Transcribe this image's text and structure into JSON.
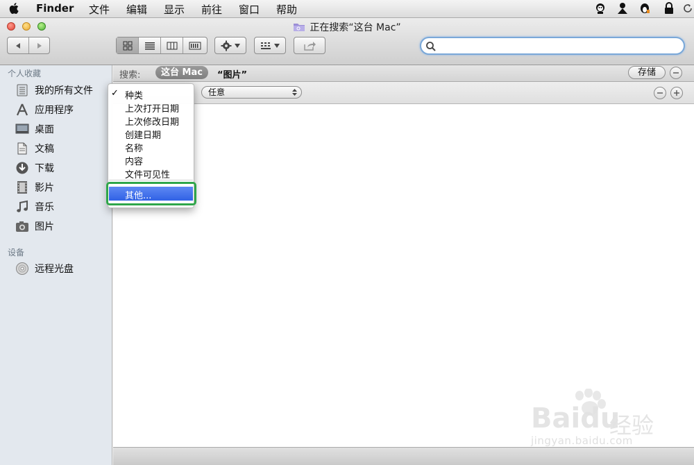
{
  "menubar": {
    "app": "Finder",
    "items": [
      "文件",
      "编辑",
      "显示",
      "前往",
      "窗口",
      "帮助"
    ]
  },
  "window": {
    "title": "正在搜索“这台 Mac”"
  },
  "toolbar": {
    "search_placeholder": ""
  },
  "sidebar": {
    "favorites_header": "个人收藏",
    "favorites": [
      {
        "label": "我的所有文件",
        "icon": "all-files-icon"
      },
      {
        "label": "应用程序",
        "icon": "applications-icon"
      },
      {
        "label": "桌面",
        "icon": "desktop-icon"
      },
      {
        "label": "文稿",
        "icon": "documents-icon"
      },
      {
        "label": "下载",
        "icon": "downloads-icon"
      },
      {
        "label": "影片",
        "icon": "movies-icon"
      },
      {
        "label": "音乐",
        "icon": "music-icon"
      },
      {
        "label": "图片",
        "icon": "pictures-icon"
      }
    ],
    "devices_header": "设备",
    "devices": [
      {
        "label": "远程光盘",
        "icon": "remote-disc-icon"
      }
    ]
  },
  "searchbar": {
    "label": "搜索:",
    "scope_this_mac": "这台 Mac",
    "scope_folder": "“图片”",
    "save_label": "存储"
  },
  "criteria": {
    "value_popup": "任意"
  },
  "dropdown": {
    "items": [
      "种类",
      "上次打开日期",
      "上次修改日期",
      "创建日期",
      "名称",
      "内容",
      "文件可见性"
    ],
    "checked_index": 0,
    "other": "其他..."
  },
  "watermark": {
    "brand": "Baidu",
    "brand_cn": "经验",
    "url": "jingyan.baidu.com"
  },
  "colors": {
    "highlight": "#3a6be8",
    "annotation_box": "#2fa64a",
    "search_focus": "#7aa8d8"
  }
}
